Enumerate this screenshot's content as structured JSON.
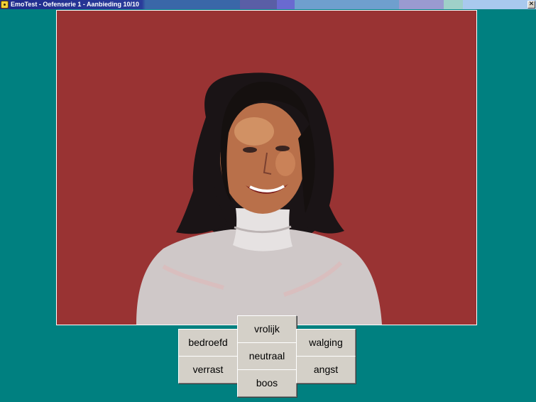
{
  "window": {
    "title": "EmoTest - Oefenserie 1 - Aanbieding 10/10",
    "close_glyph": "✕"
  },
  "stimulus": {
    "icon": "face-photo"
  },
  "buttons": {
    "bedroefd": "bedroefd",
    "verrast": "verrast",
    "vrolijk": "vrolijk",
    "neutraal": "neutraal",
    "boos": "boos",
    "walging": "walging",
    "angst": "angst"
  },
  "colors": {
    "background": "#008080",
    "photo_background": "#993333",
    "button_face": "#d4d0c8"
  }
}
